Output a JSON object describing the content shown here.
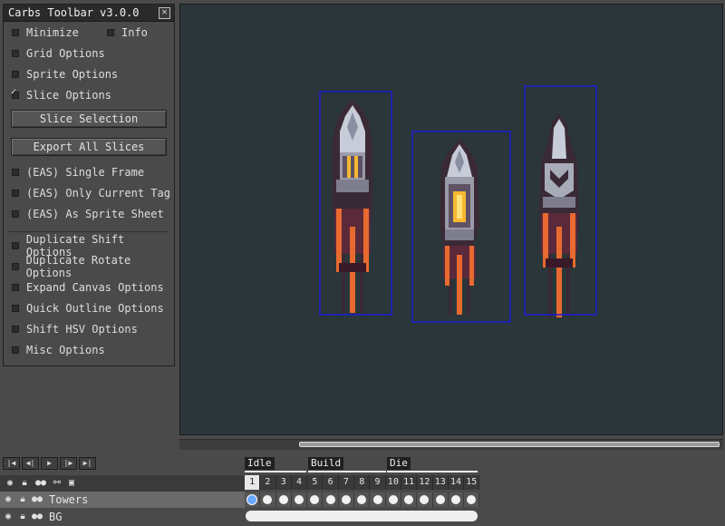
{
  "toolbar": {
    "title": "Carbs Toolbar v3.0.0",
    "minimize_label": "Minimize",
    "info_label": "Info",
    "grid_options": "Grid Options",
    "sprite_options": "Sprite Options",
    "slice_options": "Slice Options",
    "slice_selection": "Slice Selection",
    "export_all_slices": "Export All Slices",
    "eas_single_frame": "(EAS) Single Frame",
    "eas_only_current_tag": "(EAS) Only Current Tag",
    "eas_as_sprite_sheet": "(EAS) As Sprite Sheet",
    "duplicate_shift": "Duplicate Shift Options",
    "duplicate_rotate": "Duplicate Rotate Options",
    "expand_canvas": "Expand Canvas Options",
    "quick_outline": "Quick Outline Options",
    "shift_hsv": "Shift HSV Options",
    "misc_options": "Misc Options"
  },
  "timeline": {
    "tags": [
      "Idle",
      "Build",
      "Die"
    ],
    "frames": [
      "1",
      "2",
      "3",
      "4",
      "5",
      "6",
      "7",
      "8",
      "9",
      "10",
      "11",
      "12",
      "13",
      "14",
      "15"
    ],
    "layers": [
      "Towers",
      "BG"
    ]
  },
  "colors": {
    "slice_box": "#1a1ad0",
    "canvas_bg": "#2a363a"
  }
}
